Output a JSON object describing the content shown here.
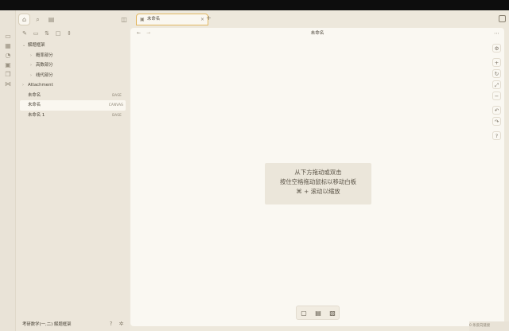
{
  "sidebar": {
    "tree": [
      {
        "label": "解题框架",
        "type": "folder-open",
        "indent": 0,
        "badge": ""
      },
      {
        "label": "概率部分",
        "type": "folder",
        "indent": 1,
        "badge": ""
      },
      {
        "label": "高数部分",
        "type": "folder",
        "indent": 1,
        "badge": ""
      },
      {
        "label": "线代部分",
        "type": "folder",
        "indent": 1,
        "badge": ""
      },
      {
        "label": "Attachment",
        "type": "folder",
        "indent": 0,
        "badge": ""
      },
      {
        "label": "未命名",
        "type": "file",
        "indent": 0,
        "badge": "BASE"
      },
      {
        "label": "未命名",
        "type": "file",
        "indent": 0,
        "badge": "CANVAS",
        "selected": true
      },
      {
        "label": "未命名 1",
        "type": "file",
        "indent": 0,
        "badge": "BASE"
      }
    ],
    "footer": {
      "vault_name": "考研数学(一,二) 解题框架"
    }
  },
  "tab": {
    "label": "未命名",
    "close": "×",
    "add": "+"
  },
  "nav": {
    "back": "←",
    "forward": "→",
    "title": "未命名",
    "more": "⋯"
  },
  "hint": {
    "line1": "从下方拖动或双击",
    "line2": "按住空格拖动鼠标以移动白板",
    "line3": "⌘ + 滚动以缩放"
  },
  "status": {
    "text": "0 条反向链接"
  },
  "icons": {
    "right_tools": [
      "gear-icon",
      "zoom-in-icon",
      "reset-icon",
      "fit-icon",
      "zoom-out-icon",
      "undo-icon",
      "redo-icon",
      "help-icon"
    ],
    "bottom_tools": [
      "add-card-icon",
      "add-note-icon",
      "add-media-icon"
    ]
  },
  "colors": {
    "accent": "#e2b863",
    "background": "#ede8dc",
    "canvas": "#faf8f2"
  }
}
